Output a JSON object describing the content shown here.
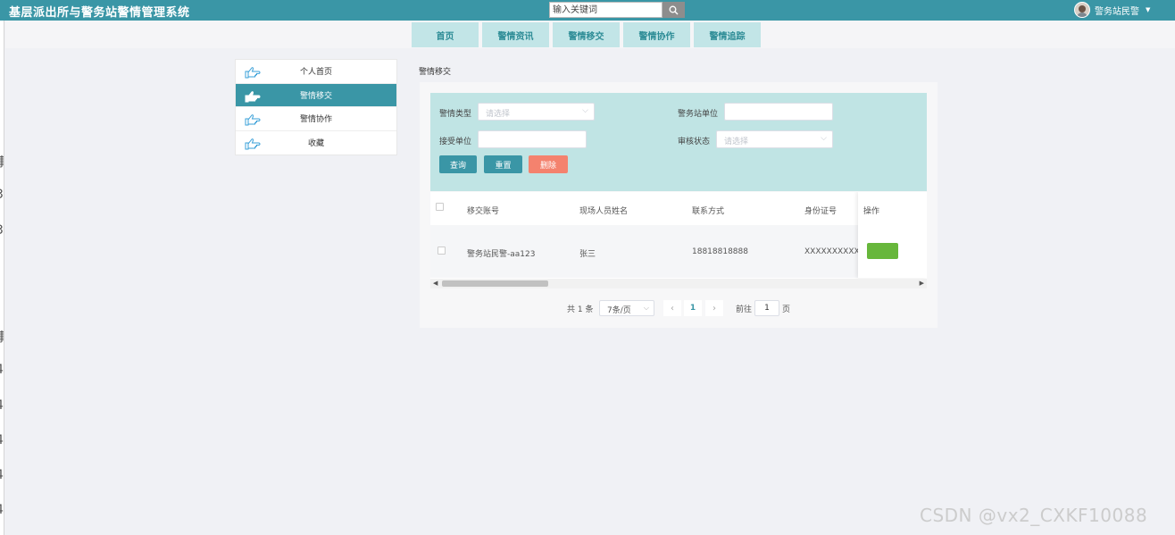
{
  "header": {
    "title": "基层派出所与警务站警情管理系统",
    "search_placeholder": "输入关键词",
    "user_name": "警务站民警"
  },
  "nav": {
    "items": [
      {
        "label": "首页"
      },
      {
        "label": "警情资讯"
      },
      {
        "label": "警情移交"
      },
      {
        "label": "警情协作"
      },
      {
        "label": "警情追踪"
      }
    ]
  },
  "sidebar": {
    "items": [
      {
        "label": "个人首页",
        "active": false
      },
      {
        "label": "警情移交",
        "active": true
      },
      {
        "label": "警情协作",
        "active": false
      },
      {
        "label": "收藏",
        "active": false
      }
    ]
  },
  "breadcrumb": "警情移交",
  "filter": {
    "type_label": "警情类型",
    "type_placeholder": "请选择",
    "station_label": "警务站单位",
    "station_value": "",
    "receiver_label": "接受单位",
    "receiver_value": "",
    "status_label": "审核状态",
    "status_placeholder": "请选择",
    "query_label": "查询",
    "reset_label": "重置",
    "delete_label": "删除"
  },
  "table": {
    "columns": [
      "移交账号",
      "现场人员姓名",
      "联系方式",
      "身份证号",
      "操作"
    ],
    "rows": [
      {
        "account": "警务站民警-aa123",
        "name": "张三",
        "phone": "18818818888",
        "id_number": "XXXXXXXXXXXX"
      }
    ]
  },
  "pagination": {
    "total_text": "共 1 条",
    "page_size": "7条/页",
    "current_page": "1",
    "goto_label": "前往",
    "goto_value": "1",
    "page_unit": "页"
  },
  "watermark": "CSDN @vx2_CXKF10088",
  "colors": {
    "header": "#3a96a6",
    "nav_item": "#c2e5e7",
    "filter_bg": "#c0e4e4",
    "delete_button": "#f4826e",
    "action_button": "#67b73b"
  }
}
